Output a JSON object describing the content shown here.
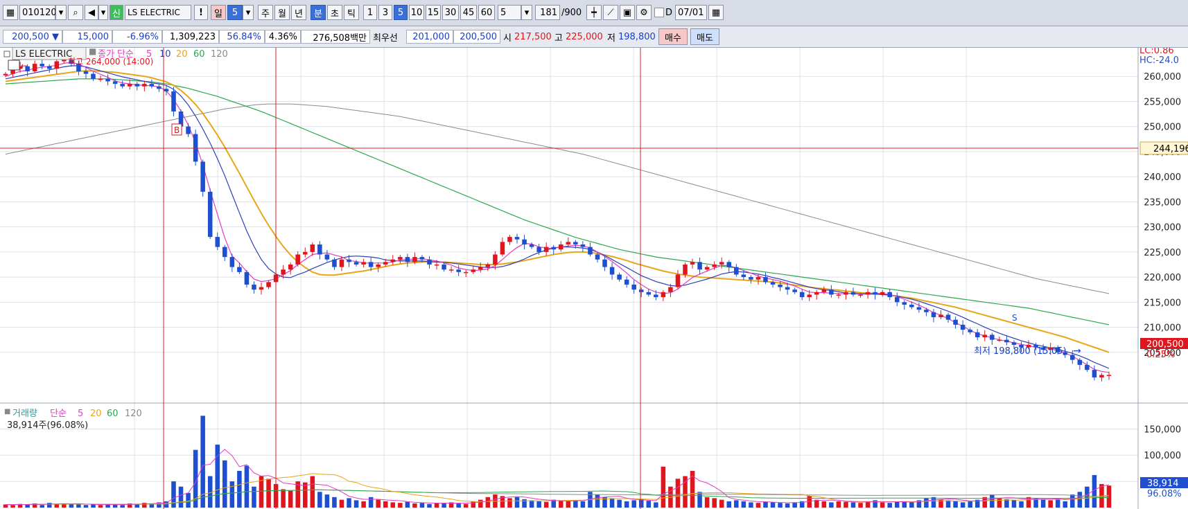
{
  "toolbar": {
    "code": "010120",
    "credit_badge": "신",
    "stock_name": "LS ELECTRIC",
    "alert_label": "!",
    "period_day": "일",
    "period_num": "5",
    "week": "주",
    "month": "월",
    "year": "년",
    "minute": "분",
    "second": "초",
    "tick": "틱",
    "intervals": [
      "1",
      "3",
      "5",
      "10",
      "15",
      "30",
      "45",
      "60"
    ],
    "selected_interval": "5",
    "count": "5",
    "bars_shown": "181",
    "bars_total": "/900",
    "d_label": "D",
    "date": "07/01"
  },
  "quote": {
    "price": "200,500",
    "change": "15,000",
    "change_pct": "-6.96%",
    "volume": "1,309,223",
    "vol_ratio": "56.84%",
    "turnover_pct": "4.36%",
    "amount": "276,508백만",
    "best_label": "최우선",
    "best_bid": "201,000",
    "best_ask": "200,500",
    "open_label": "시",
    "open": "217,500",
    "high_label": "고",
    "high": "225,000",
    "low_label": "저",
    "low": "198,800",
    "buy_label": "매수",
    "sell_label": "매도"
  },
  "price_panel": {
    "legend_name": "LS ELECTRIC",
    "legend_type": "종가 단순",
    "ma_periods": [
      "5",
      "10",
      "20",
      "60",
      "120"
    ],
    "high_marker": "최고 264,000 (14:00)",
    "low_marker": "최저 198,800 (15:05)",
    "lc": "LC:0.86",
    "hc": "HC:-24.0",
    "crosshair_value": "244,196",
    "last_price_tag": "200,500",
    "last_pct_tag": "0.25%",
    "signal_b": "B",
    "signal_s": "S"
  },
  "volume_panel": {
    "legend_name": "거래량",
    "legend_type": "단순",
    "ma_periods": [
      "5",
      "20",
      "60",
      "120"
    ],
    "current": "38,914주(96.08%)",
    "last_tag": "38,914",
    "last_pct_tag": "96.08%"
  },
  "colors": {
    "up": "#e0161e",
    "down": "#1f4fd1",
    "ma5": "#e03cc0",
    "ma10": "#2b3fb8",
    "ma20": "#e8a516",
    "ma60": "#2aa84a",
    "ma120": "#8a8a8a",
    "crosshair": "#d42020"
  },
  "chart_data": {
    "type": "candlestick",
    "y_axis_ticks": [
      260000,
      255000,
      250000,
      245000,
      240000,
      235000,
      230000,
      225000,
      220000,
      215000,
      210000,
      205000
    ],
    "volume_axis_ticks": [
      150000,
      100000,
      50000
    ],
    "ylim": [
      196000,
      265000
    ],
    "volume_ylim": [
      0,
      190000
    ],
    "close": [
      260500,
      261500,
      262000,
      261000,
      262500,
      262000,
      261500,
      263000,
      264000,
      262500,
      261000,
      260500,
      259500,
      259500,
      259000,
      258500,
      258000,
      258500,
      258000,
      258500,
      258000,
      257500,
      257000,
      253000,
      250000,
      248500,
      243000,
      237000,
      228000,
      226000,
      224000,
      222000,
      221000,
      218500,
      217500,
      218000,
      219000,
      220500,
      221500,
      222500,
      224500,
      225000,
      226500,
      224500,
      223500,
      222000,
      223500,
      223000,
      222500,
      223000,
      222000,
      222500,
      223000,
      223500,
      224000,
      223000,
      224000,
      223500,
      222500,
      222500,
      221500,
      221500,
      221000,
      221000,
      221500,
      222000,
      222500,
      224500,
      227000,
      228000,
      227500,
      226500,
      226000,
      225000,
      226000,
      225500,
      226500,
      227000,
      226500,
      226000,
      224500,
      223500,
      222000,
      220500,
      219500,
      218500,
      217500,
      217000,
      216500,
      216000,
      217000,
      218000,
      220500,
      222500,
      223000,
      221500,
      222000,
      222500,
      223000,
      222000,
      220500,
      220000,
      219500,
      220000,
      219000,
      218500,
      218000,
      217500,
      217000,
      216000,
      216500,
      217000,
      217500,
      216500,
      216500,
      217000,
      216500,
      216500,
      217000,
      216500,
      217000,
      216000,
      215000,
      214500,
      214000,
      213500,
      213000,
      212000,
      212500,
      211500,
      210500,
      209500,
      209000,
      208000,
      208500,
      207500,
      207500,
      207000,
      206500,
      206000,
      206500,
      206000,
      205500,
      206000,
      205000,
      204500,
      203500,
      202500,
      201500,
      200000,
      200500,
      200500
    ],
    "ma5": [
      260000,
      260500,
      261000,
      261200,
      261600,
      261800,
      262000,
      262200,
      262600,
      262800,
      262400,
      261800,
      261000,
      260400,
      259800,
      259100,
      258700,
      258500,
      258300,
      258200,
      258100,
      257900,
      257100,
      255400,
      253100,
      250300,
      246800,
      242300,
      237300,
      232500,
      227800,
      224200,
      222800,
      221100,
      219600,
      219100,
      219300,
      219700,
      220500,
      221300,
      222500,
      223500,
      224500,
      224700,
      224800,
      224400,
      224000,
      223300,
      223100,
      222800,
      222800,
      222800,
      222800,
      223000,
      223400,
      223500,
      223600,
      223700,
      223400,
      223200,
      222800,
      222400,
      221800,
      221500,
      221300,
      221400,
      221600,
      222300,
      223500,
      224800,
      225900,
      226700,
      226600,
      226000,
      225800,
      225700,
      226000,
      226200,
      226300,
      226200,
      225800,
      225000,
      224100,
      223100,
      222000,
      220800,
      219500,
      218500,
      217600,
      217000,
      216700,
      216900,
      217600,
      218800,
      219900,
      220600,
      221200,
      221800,
      222300,
      222300,
      221800,
      221300,
      220800,
      220200,
      219800,
      219500,
      219200,
      218700,
      218200,
      217600,
      217000,
      216900,
      216900,
      216800,
      216700,
      216700,
      216800,
      216700,
      216800,
      216800,
      216700,
      216500,
      216100,
      215600,
      215000,
      214400,
      213700,
      212900,
      212400,
      211700,
      210900,
      210200,
      209400,
      208700,
      208300,
      207900,
      207500,
      207200,
      206900,
      206600,
      206300,
      206000,
      205800,
      205700,
      205300,
      204900,
      204200,
      203400,
      202500,
      201600,
      201200,
      201000
    ],
    "ma10": [
      259500,
      259800,
      260100,
      260400,
      260700,
      261000,
      261300,
      261600,
      261900,
      262100,
      262100,
      261900,
      261500,
      261100,
      260700,
      260300,
      259900,
      259600,
      259300,
      259000,
      258700,
      258500,
      258200,
      257400,
      256100,
      254300,
      252100,
      249500,
      246700,
      243600,
      240200,
      236500,
      232800,
      229200,
      226100,
      223500,
      221700,
      220600,
      220000,
      219900,
      220500,
      221000,
      221700,
      222300,
      222900,
      223400,
      223800,
      224100,
      224200,
      224100,
      224000,
      223800,
      223400,
      223300,
      223200,
      223200,
      223200,
      223200,
      223100,
      223000,
      222900,
      222800,
      222600,
      222400,
      222200,
      222000,
      221900,
      221900,
      222100,
      222500,
      223000,
      223600,
      224300,
      224900,
      225400,
      225800,
      226000,
      226000,
      225900,
      225800,
      225500,
      225000,
      224300,
      223500,
      222700,
      221900,
      221100,
      220300,
      219700,
      219100,
      218700,
      218300,
      218200,
      218400,
      218800,
      219200,
      219600,
      220100,
      220600,
      220900,
      221100,
      221000,
      220800,
      220600,
      220300,
      219900,
      219600,
      219200,
      218800,
      218400,
      218000,
      217700,
      217500,
      217300,
      217100,
      216800,
      216700,
      216600,
      216600,
      216600,
      216500,
      216400,
      216200,
      215900,
      215600,
      215200,
      214700,
      214200,
      213700,
      213200,
      212600,
      212000,
      211300,
      210700,
      210000,
      209400,
      208800,
      208300,
      207800,
      207300,
      206900,
      206500,
      206200,
      205900,
      205600,
      205200,
      204800,
      204300,
      203700,
      203000,
      202400,
      201800
    ],
    "ma20": [
      259000,
      259200,
      259400,
      259600,
      259800,
      260000,
      260200,
      260400,
      260600,
      260800,
      261000,
      261100,
      261100,
      261000,
      260900,
      260800,
      260600,
      260400,
      260200,
      260000,
      259700,
      259300,
      258900,
      258200,
      257200,
      255900,
      254400,
      252600,
      250500,
      248300,
      245900,
      243300,
      240700,
      238000,
      235300,
      232700,
      230300,
      228100,
      226100,
      224400,
      223000,
      221900,
      221000,
      220500,
      220400,
      220400,
      220600,
      220800,
      221000,
      221200,
      221500,
      221800,
      222100,
      222400,
      222600,
      222800,
      222900,
      223000,
      223000,
      223000,
      223000,
      222900,
      222800,
      222700,
      222600,
      222500,
      222500,
      222500,
      222600,
      222800,
      223000,
      223300,
      223600,
      223900,
      224200,
      224500,
      224700,
      224900,
      225000,
      225000,
      224900,
      224700,
      224400,
      224100,
      223700,
      223300,
      222800,
      222400,
      222000,
      221600,
      221200,
      220900,
      220600,
      220400,
      220200,
      220000,
      219900,
      219800,
      219700,
      219600,
      219500,
      219400,
      219300,
      219200,
      219100,
      219000,
      218800,
      218600,
      218400,
      218200,
      218000,
      217800,
      217700,
      217500,
      217400,
      217200,
      217100,
      216900,
      216800,
      216700,
      216600,
      216400,
      216200,
      216000,
      215800,
      215500,
      215200,
      214900,
      214600,
      214300,
      214000,
      213600,
      213200,
      212800,
      212400,
      212000,
      211600,
      211200,
      210800,
      210400,
      210000,
      209600,
      209200,
      208800,
      208400,
      208000,
      207500,
      207000,
      206500,
      206000,
      205500,
      205000
    ],
    "ma60": [
      258500,
      258600,
      258700,
      258800,
      258900,
      259000,
      259100,
      259200,
      259300,
      259400,
      259500,
      259500,
      259500,
      259500,
      259500,
      259400,
      259300,
      259200,
      259100,
      259000,
      258900,
      258700,
      258500,
      258200,
      257900,
      257600,
      257200,
      256800,
      256400,
      256000,
      255500,
      255000,
      254500,
      254000,
      253500,
      253000,
      252400,
      251800,
      251200,
      250600,
      250000,
      249400,
      248800,
      248200,
      247600,
      247000,
      246400,
      245800,
      245200,
      244600,
      244000,
      243400,
      242800,
      242200,
      241600,
      241000,
      240400,
      239800,
      239200,
      238600,
      238000,
      237400,
      236800,
      236200,
      235600,
      235000,
      234400,
      233800,
      233200,
      232600,
      232000,
      231400,
      230900,
      230400,
      229900,
      229400,
      228900,
      228400,
      227900,
      227500,
      227100,
      226700,
      226300,
      225900,
      225500,
      225200,
      224900,
      224600,
      224300,
      224000,
      223800,
      223600,
      223400,
      223200,
      223000,
      222800,
      222600,
      222400,
      222200,
      222000,
      221800,
      221600,
      221400,
      221200,
      221000,
      220800,
      220600,
      220400,
      220200,
      220000,
      219800,
      219600,
      219400,
      219200,
      219000,
      218800,
      218600,
      218400,
      218200,
      218000,
      217800,
      217600,
      217400,
      217200,
      217000,
      216800,
      216600,
      216400,
      216200,
      216000,
      215800,
      215600,
      215400,
      215200,
      215000,
      214800,
      214600,
      214400,
      214200,
      214000,
      213800,
      213500,
      213200,
      212900,
      212600,
      212300,
      212000,
      211700,
      211400,
      211100,
      210800,
      210500
    ],
    "ma120": [
      244500,
      244800,
      245100,
      245400,
      245700,
      246000,
      246300,
      246600,
      246900,
      247200,
      247500,
      247800,
      248100,
      248400,
      248700,
      249000,
      249300,
      249600,
      249900,
      250200,
      250500,
      250800,
      251100,
      251400,
      251700,
      252000,
      252300,
      252600,
      252900,
      253200,
      253500,
      253700,
      253900,
      254100,
      254300,
      254400,
      254500,
      254500,
      254500,
      254500,
      254400,
      254300,
      254200,
      254100,
      254000,
      253800,
      253600,
      253400,
      253200,
      253000,
      252800,
      252600,
      252400,
      252200,
      252000,
      251700,
      251400,
      251100,
      250800,
      250500,
      250200,
      249900,
      249600,
      249300,
      249000,
      248700,
      248400,
      248100,
      247800,
      247500,
      247200,
      246900,
      246600,
      246300,
      246000,
      245700,
      245400,
      245100,
      244800,
      244500,
      244100,
      243700,
      243300,
      242900,
      242500,
      242100,
      241700,
      241300,
      240900,
      240500,
      240100,
      239700,
      239300,
      238900,
      238500,
      238100,
      237700,
      237300,
      236900,
      236500,
      236100,
      235700,
      235300,
      234900,
      234500,
      234100,
      233700,
      233300,
      232900,
      232500,
      232100,
      231700,
      231300,
      230900,
      230500,
      230100,
      229700,
      229300,
      228900,
      228500,
      228100,
      227700,
      227300,
      226900,
      226500,
      226100,
      225700,
      225300,
      224900,
      224500,
      224100,
      223700,
      223300,
      222900,
      222500,
      222100,
      221700,
      221300,
      220900,
      220500,
      220100,
      219700,
      219400,
      219100,
      218800,
      218500,
      218200,
      217900,
      217600,
      217300,
      217000,
      216700
    ],
    "volume": [
      6000,
      5000,
      7000,
      6000,
      8000,
      5000,
      9000,
      7000,
      8000,
      6000,
      7000,
      5000,
      6000,
      5000,
      7000,
      6000,
      5000,
      8000,
      7000,
      9000,
      8000,
      10000,
      12000,
      50000,
      40000,
      28000,
      110000,
      175000,
      60000,
      120000,
      90000,
      50000,
      70000,
      80000,
      40000,
      60000,
      55000,
      45000,
      35000,
      32000,
      50000,
      48000,
      60000,
      30000,
      25000,
      20000,
      15000,
      18000,
      14000,
      12000,
      20000,
      15000,
      12000,
      10000,
      9000,
      11000,
      8000,
      9000,
      7000,
      8000,
      9000,
      10000,
      8000,
      7000,
      12000,
      15000,
      20000,
      25000,
      22000,
      18000,
      20000,
      16000,
      14000,
      12000,
      11000,
      15000,
      13000,
      12000,
      14000,
      12000,
      30000,
      25000,
      20000,
      18000,
      15000,
      12000,
      14000,
      16000,
      13000,
      10000,
      78000,
      40000,
      55000,
      60000,
      70000,
      30000,
      20000,
      18000,
      15000,
      12000,
      14000,
      12000,
      10000,
      9000,
      11000,
      10000,
      9000,
      8000,
      10000,
      12000,
      22000,
      15000,
      12000,
      10000,
      12000,
      11000,
      10000,
      9000,
      12000,
      14000,
      10000,
      9000,
      11000,
      12000,
      10000,
      14000,
      18000,
      20000,
      16000,
      14000,
      12000,
      10000,
      12000,
      15000,
      20000,
      25000,
      18000,
      16000,
      14000,
      12000,
      20000,
      18000,
      16000,
      14000,
      15000,
      12000,
      25000,
      30000,
      40000,
      62000,
      45000,
      42000
    ]
  }
}
